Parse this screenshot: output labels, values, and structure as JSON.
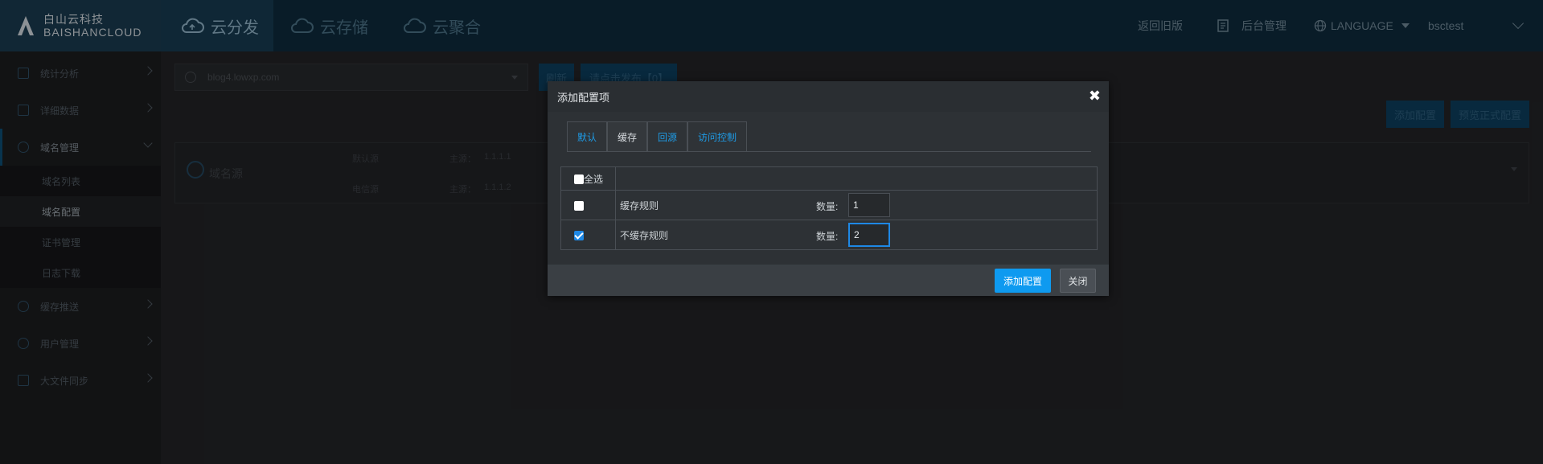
{
  "logo": {
    "cn": "白山云科技",
    "en": "BAISHANCLOUD"
  },
  "products": [
    {
      "label": "云分发",
      "icon": "cloud-upload-icon"
    },
    {
      "label": "云存储",
      "icon": "cloud-icon"
    },
    {
      "label": "云聚合",
      "icon": "cloud-icon"
    }
  ],
  "topbar": {
    "back_old": "返回旧版",
    "admin": "后台管理",
    "language": "LANGUAGE",
    "user": "bsctest"
  },
  "sidebar": {
    "items": [
      {
        "label": "统计分析",
        "icon": "chart-icon"
      },
      {
        "label": "详细数据",
        "icon": "list-icon"
      },
      {
        "label": "域名管理",
        "icon": "globe-icon"
      },
      {
        "label": "缓存推送",
        "icon": "refresh-icon"
      },
      {
        "label": "用户管理",
        "icon": "user-icon"
      },
      {
        "label": "大文件同步",
        "icon": "folder-icon"
      }
    ],
    "subitems": [
      "域名列表",
      "域名配置",
      "证书管理",
      "日志下载"
    ]
  },
  "main": {
    "domain_value": "blog4.lowxp.com",
    "refresh": "刷新",
    "publish": "请点击发布【0】",
    "add_config": "添加配置",
    "preview": "预览正式配置",
    "card": {
      "title": "域名源",
      "row1_key": "默认源",
      "row1_src": "主源：",
      "row1_val": "1.1.1.1",
      "row2_key": "电信源",
      "row2_src": "主源：",
      "row2_val": "1.1.1.2"
    }
  },
  "modal": {
    "title": "添加配置项",
    "close": "✖",
    "tabs": [
      "默认",
      "缓存",
      "回源",
      "访问控制"
    ],
    "active_tab": "缓存",
    "select_all": "全选",
    "rows": [
      {
        "name": "缓存规则",
        "qty_label": "数量:",
        "qty": "1",
        "checked": false
      },
      {
        "name": "不缓存规则",
        "qty_label": "数量:",
        "qty": "2",
        "checked": true
      }
    ],
    "ok": "添加配置",
    "cancel": "关闭"
  }
}
